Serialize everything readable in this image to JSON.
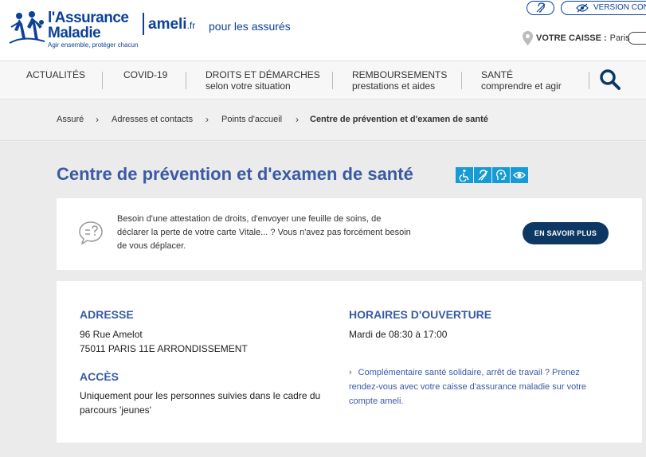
{
  "header": {
    "logo_line1": "l'Assurance",
    "logo_line2": "Maladie",
    "logo_tagline": "Agir ensemble, protéger chacun",
    "ameli_name": "ameli",
    "ameli_tld": ".fr",
    "audience": "pour les assurés",
    "accessibility_icon": "ear-icon",
    "version_label": "VERSION CON",
    "caisse_label": "VOTRE CAISSE :",
    "caisse_city": "Paris"
  },
  "nav": {
    "items": [
      {
        "line1": "ACTUALITÉS",
        "line2": ""
      },
      {
        "line1": "COVID-19",
        "line2": ""
      },
      {
        "line1": "DROITS ET DÉMARCHES",
        "line2": "selon votre situation"
      },
      {
        "line1": "REMBOURSEMENTS",
        "line2": "prestations et aides"
      },
      {
        "line1": "SANTÉ",
        "line2": "comprendre et agir"
      }
    ]
  },
  "breadcrumb": {
    "items": [
      "Assuré",
      "Adresses et contacts",
      "Points d'accueil",
      "Centre de prévention et d'examen de santé"
    ],
    "separator": "›"
  },
  "page": {
    "title": "Centre de prévention et d'examen de santé",
    "accessibility_icons": [
      "wheelchair-icon",
      "hearing-icon",
      "mental-disability-icon",
      "visual-disability-icon"
    ]
  },
  "info": {
    "line1": "Besoin d'une attestation de droits, d'envoyer une feuille de soins, de",
    "line2": "déclarer la perte de votre carte Vitale... ? Vous n'avez pas forcément besoin",
    "line3": "de vous déplacer.",
    "button": "EN SAVOIR PLUS"
  },
  "details": {
    "address_heading": "ADRESSE",
    "address_line1": "96 Rue Amelot",
    "address_line2": "75011 PARIS 11E ARRONDISSEMENT",
    "access_heading": "ACCÈS",
    "access_line1": "Uniquement pour les personnes suivies dans le cadre du",
    "access_line2": "parcours 'jeunes'",
    "hours_heading": "HORAIRES D'OUVERTURE",
    "hours": "Mardi de 08:30 à 17:00",
    "note_line1": "Complémentaire santé solidaire, arrêt de travail ? Prenez",
    "note_line2": "rendez-vous avec votre caisse d'assurance maladie sur votre",
    "note_line3": "compte ameli."
  }
}
